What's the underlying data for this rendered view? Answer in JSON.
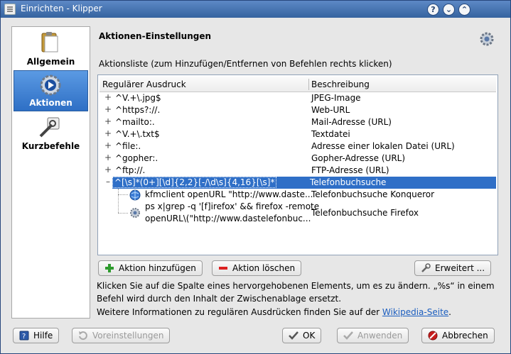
{
  "window": {
    "title": "Einrichten - Klipper",
    "buttons": [
      "?",
      "⌄",
      "⌃"
    ]
  },
  "sidebar": {
    "items": [
      {
        "label": "Allgemein",
        "icon": "clipboard-icon"
      },
      {
        "label": "Aktionen",
        "icon": "gear-play-icon",
        "active": true
      },
      {
        "label": "Kurzbefehle",
        "icon": "keyboard-shortcut-icon"
      }
    ]
  },
  "page": {
    "title": "Aktionen-Einstellungen",
    "list_label": "Aktionsliste (zum Hinzufügen/Entfernen von Befehlen rechts klicken)"
  },
  "tree": {
    "columns": [
      "Regulärer Ausdruck",
      "Beschreibung"
    ],
    "rows": [
      {
        "regex": "^V.+\\.jpg$",
        "desc": "JPEG-Image"
      },
      {
        "regex": "^https?://.",
        "desc": "Web-URL"
      },
      {
        "regex": "^mailto:.",
        "desc": "Mail-Adresse (URL)"
      },
      {
        "regex": "^V.+\\.txt$",
        "desc": "Textdatei"
      },
      {
        "regex": "^file:.",
        "desc": "Adresse einer lokalen Datei (URL)"
      },
      {
        "regex": "^gopher:.",
        "desc": "Gopher-Adresse (URL)"
      },
      {
        "regex": "^ftp://.",
        "desc": "FTP-Adresse (URL)"
      },
      {
        "regex": "^[\\s]*(0+][\\d]{2,2}[-/\\d\\s]{4,16}[\\s]*",
        "desc": "Telefonbuchsuche",
        "selected": true
      }
    ],
    "children": [
      {
        "cmd": "kfmclient openURL \"http://www.daste...",
        "desc": "Telefonbuchsuche Konqueror"
      },
      {
        "cmd_line1": "ps x|grep -q '[f]irefox' && firefox -remote",
        "cmd_line2": "openURL\\(\"http://www.dastelefonbuc...",
        "desc": "Telefonbuchsuche Firefox"
      }
    ],
    "expander_collapsed": "+",
    "expander_expanded": "–"
  },
  "actions": {
    "add": "Aktion hinzufügen",
    "remove": "Aktion löschen",
    "advanced": "Erweitert ..."
  },
  "info": {
    "line1": "Klicken Sie auf die Spalte eines hervorgehobenen Elements, um es zu ändern. „%s“ in einem",
    "line2": "Befehl wird durch den Inhalt der Zwischenablage ersetzt.",
    "line3_prefix": "Weitere Informationen zu regulären Ausdrücken finden Sie auf der ",
    "line3_link": "Wikipedia-Seite",
    "line3_suffix": "."
  },
  "footer": {
    "help": "Hilfe",
    "defaults": "Voreinstellungen",
    "ok": "OK",
    "apply": "Anwenden",
    "cancel": "Abbrechen"
  }
}
